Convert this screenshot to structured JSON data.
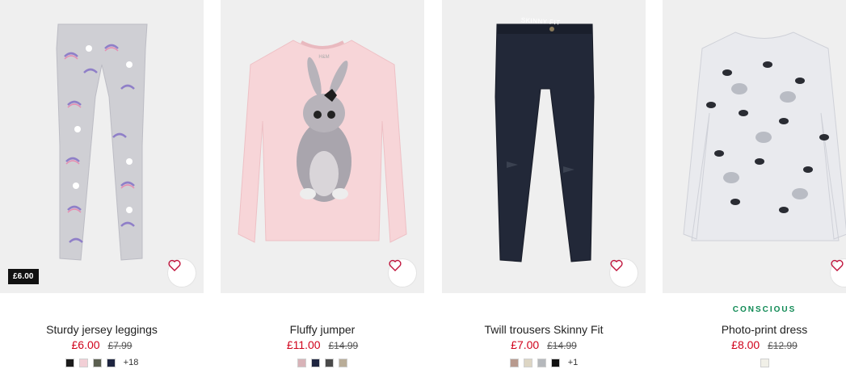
{
  "products": [
    {
      "promo_tag": "£6.00",
      "label": "",
      "title": "Sturdy jersey leggings",
      "price": "£6.00",
      "old_price": "£7.99",
      "swatches": [
        "#1c1c1c",
        "#f2cfd6",
        "#5b5f50",
        "#1e2540"
      ],
      "more": "+18"
    },
    {
      "promo_tag": "",
      "label": "",
      "title": "Fluffy jumper",
      "price": "£11.00",
      "old_price": "£14.99",
      "swatches": [
        "#d8b3b8",
        "#1e2540",
        "#4a4a4a",
        "#b9ad98"
      ],
      "more": ""
    },
    {
      "promo_tag": "",
      "label": "",
      "title": "Twill trousers Skinny Fit",
      "price": "£7.00",
      "old_price": "£14.99",
      "swatches": [
        "#b89a8e",
        "#ddd6c4",
        "#b5b8bc",
        "#111111"
      ],
      "more": "+1",
      "image_text": "SKINNY FIT"
    },
    {
      "promo_tag": "",
      "label": "CONSCIOUS",
      "title": "Photo-print dress",
      "price": "£8.00",
      "old_price": "£12.99",
      "swatches": [
        "#f1f0e8"
      ],
      "more": ""
    }
  ],
  "icons": {
    "favourite": "heart-outline-icon"
  },
  "colors": {
    "sale_price": "#d0021b",
    "conscious_green": "#108a55",
    "image_bg": "#efefef"
  }
}
